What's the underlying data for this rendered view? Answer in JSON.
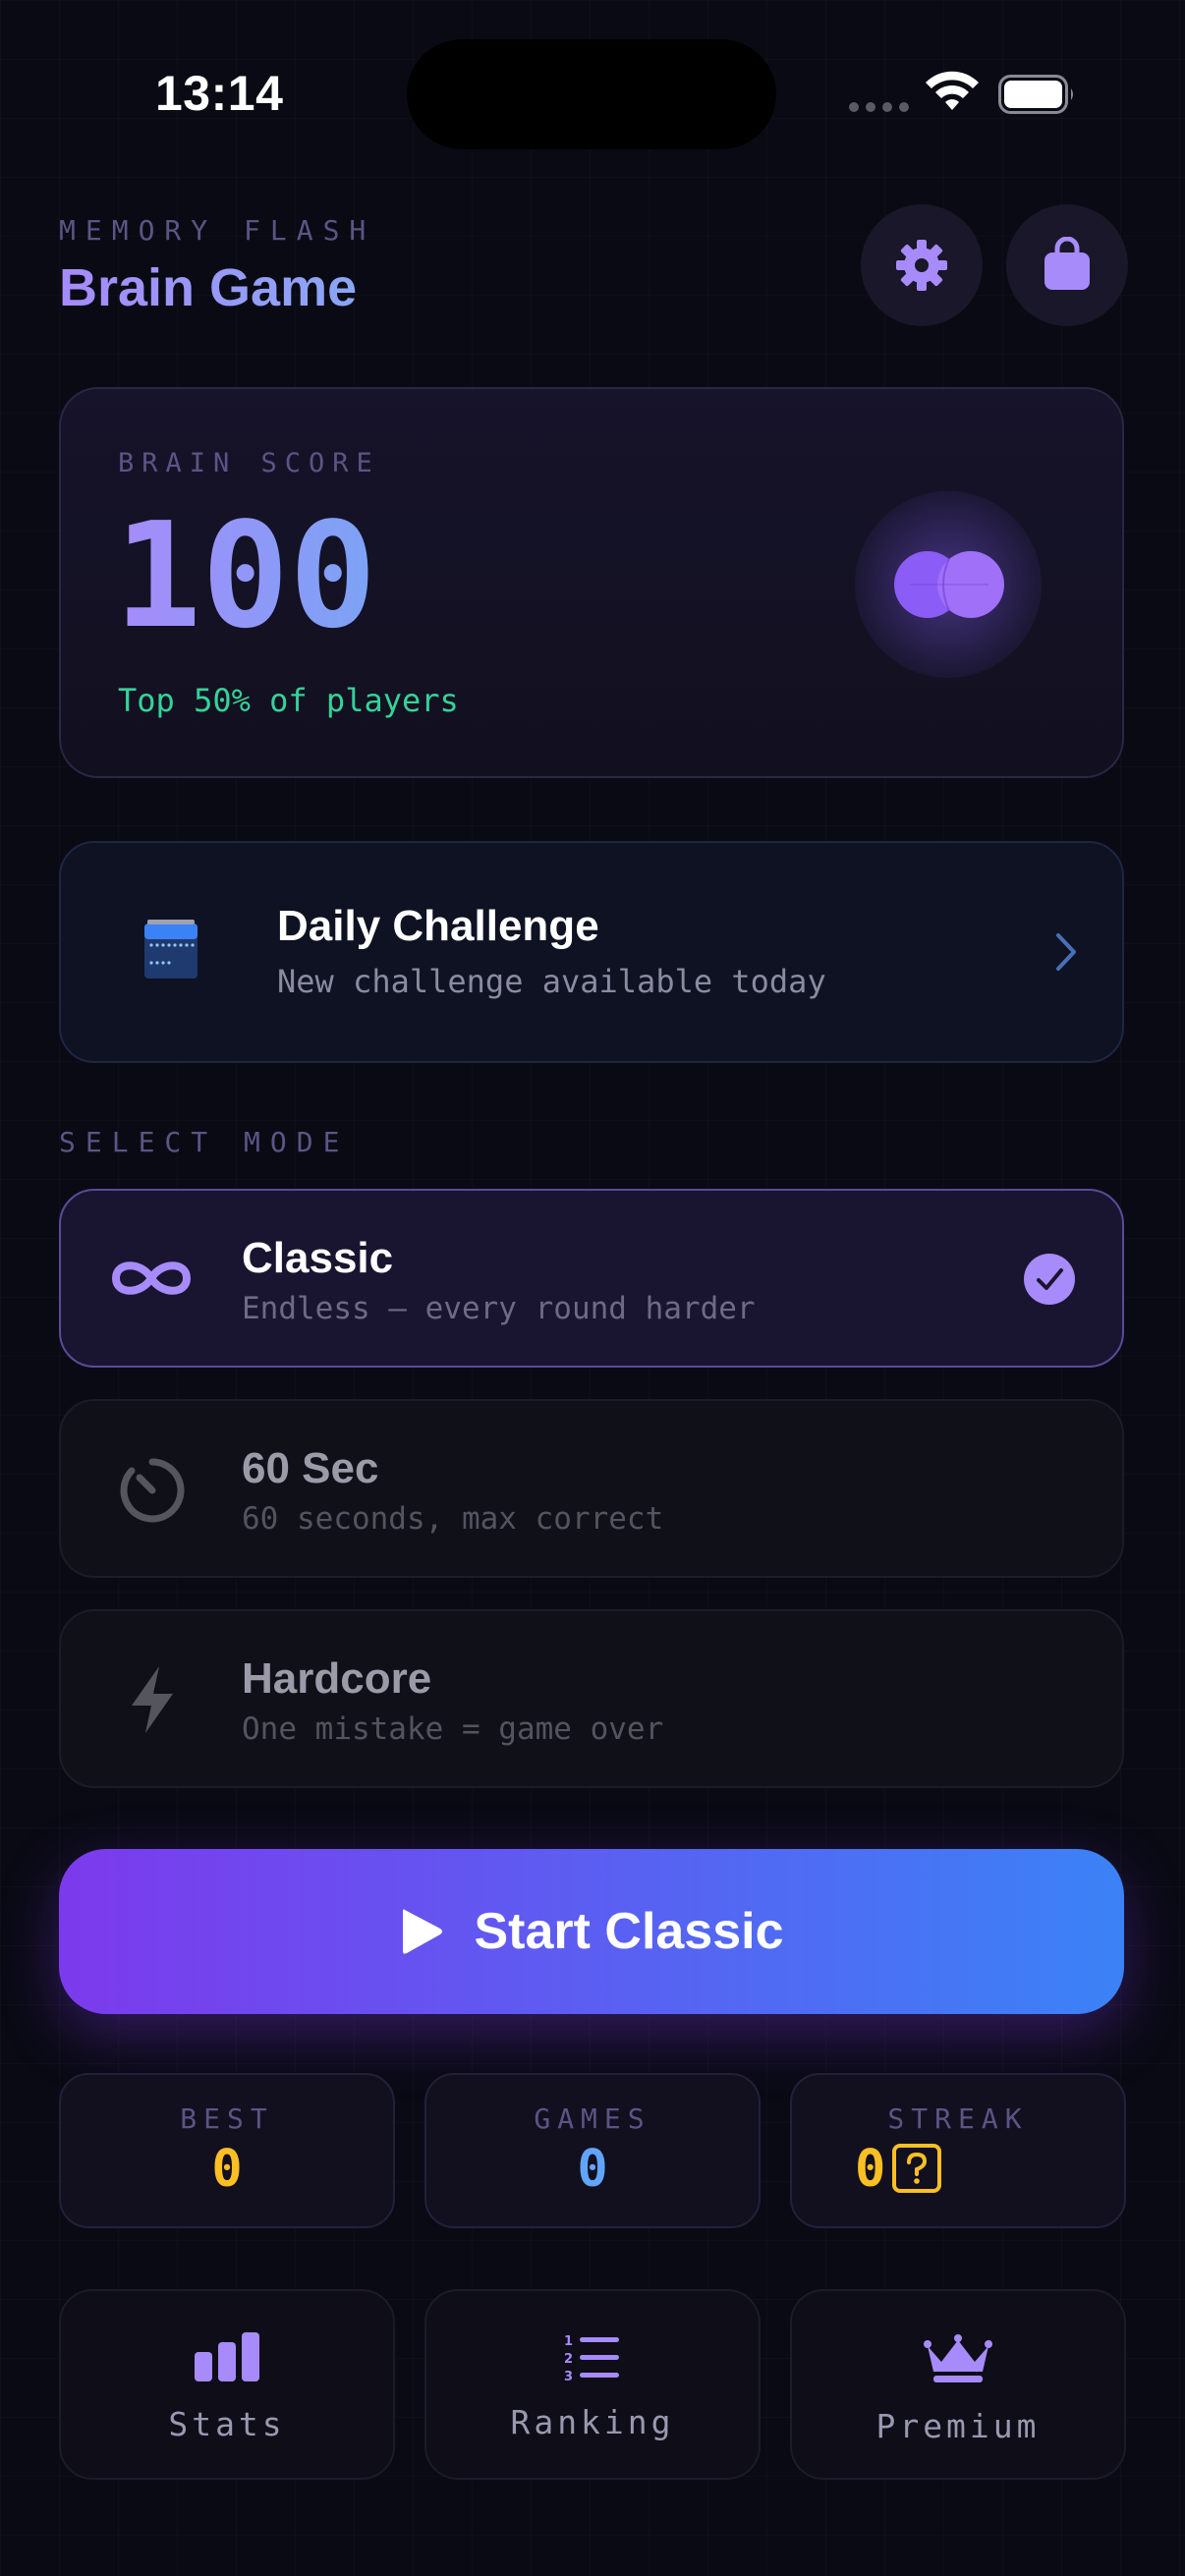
{
  "status_bar": {
    "time": "13:14"
  },
  "header": {
    "eyebrow": "MEMORY FLASH",
    "title": "Brain Game"
  },
  "score_card": {
    "label": "BRAIN SCORE",
    "score": "100",
    "subtitle": "Top 50% of players"
  },
  "daily": {
    "title": "Daily Challenge",
    "subtitle": "New challenge available today"
  },
  "modes_label": "SELECT MODE",
  "modes": [
    {
      "title": "Classic",
      "subtitle": "Endless — every round harder",
      "selected": true,
      "icon": "infinity-icon"
    },
    {
      "title": "60 Sec",
      "subtitle": "60 seconds, max correct",
      "selected": false,
      "icon": "timer-icon"
    },
    {
      "title": "Hardcore",
      "subtitle": "One mistake = game over",
      "selected": false,
      "icon": "lightning-icon"
    }
  ],
  "start_button": {
    "label": "Start Classic"
  },
  "stats": [
    {
      "label": "BEST",
      "value": "0",
      "color": "#fbbf24"
    },
    {
      "label": "GAMES",
      "value": "0",
      "color": "#60a5fa"
    },
    {
      "label": "STREAK",
      "value": "0",
      "color": "#fbbf24"
    }
  ],
  "nav": [
    {
      "label": "Stats",
      "icon": "bar-chart-icon"
    },
    {
      "label": "Ranking",
      "icon": "numbered-list-icon"
    },
    {
      "label": "Premium",
      "icon": "crown-icon"
    }
  ],
  "colors": {
    "accent": "#a78bfa",
    "accent_blue": "#3b82f6",
    "success": "#34d399",
    "gold": "#fbbf24"
  }
}
